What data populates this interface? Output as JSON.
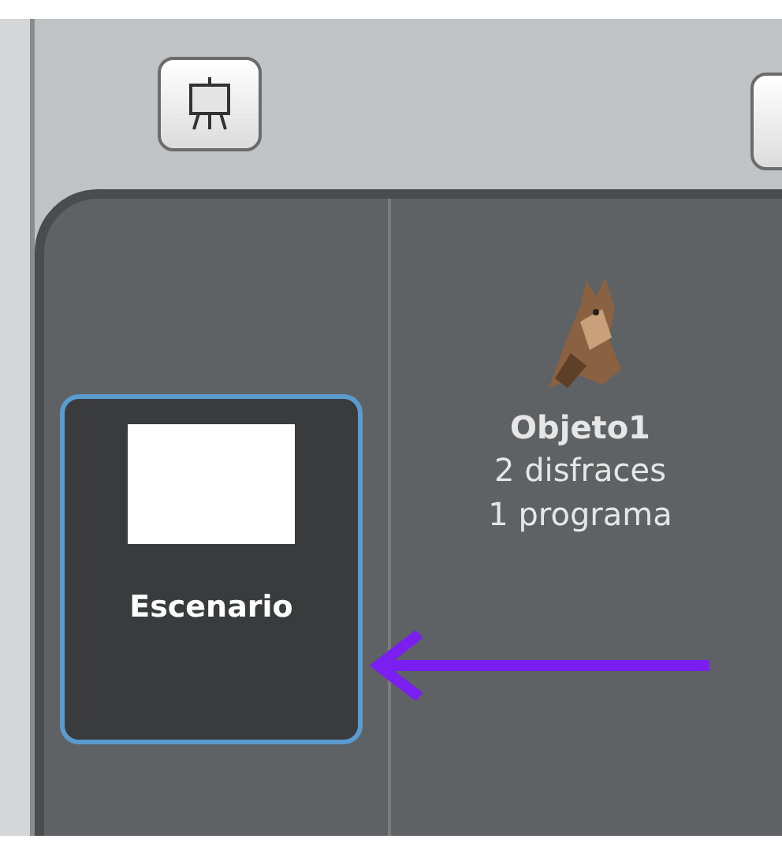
{
  "stage_card": {
    "label": "Escenario",
    "selected": true
  },
  "sprites": [
    {
      "name": "Objeto1",
      "costumes": "2 disfraces",
      "scripts": "1 programa"
    }
  ]
}
